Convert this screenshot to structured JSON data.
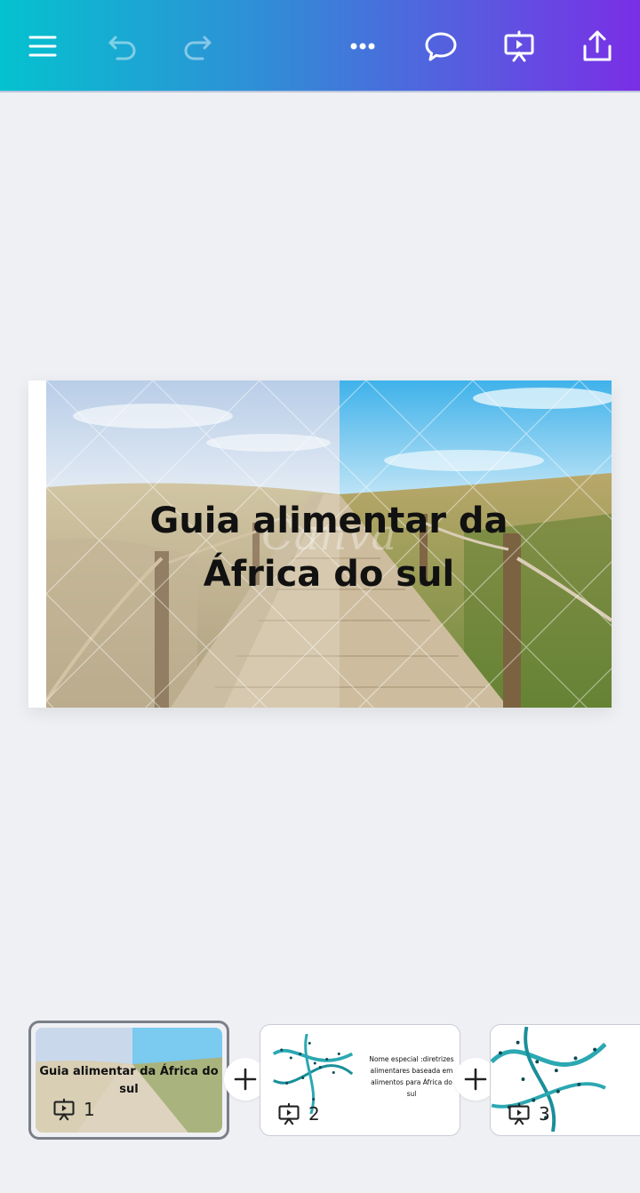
{
  "toolbar": {
    "menu_icon": "hamburger-menu-icon",
    "undo_icon": "undo-icon",
    "redo_icon": "redo-icon",
    "more_icon": "more-horizontal-icon",
    "comment_icon": "comment-icon",
    "present_icon": "present-icon",
    "share_icon": "share-upload-icon",
    "gradient_start": "#04c2cf",
    "gradient_end": "#7a2ee6"
  },
  "slide": {
    "title": "Guia alimentar da África do sul"
  },
  "thumbnails": [
    {
      "number": "1",
      "title": "Guia alimentar da África do sul",
      "selected": true
    },
    {
      "number": "2",
      "text": "Nome especial :diretrizes alimentares baseada em alimentos para África do sul",
      "selected": false
    },
    {
      "number": "3",
      "selected": false
    }
  ],
  "colors": {
    "background": "#eff0f4",
    "title_text": "#111111"
  }
}
